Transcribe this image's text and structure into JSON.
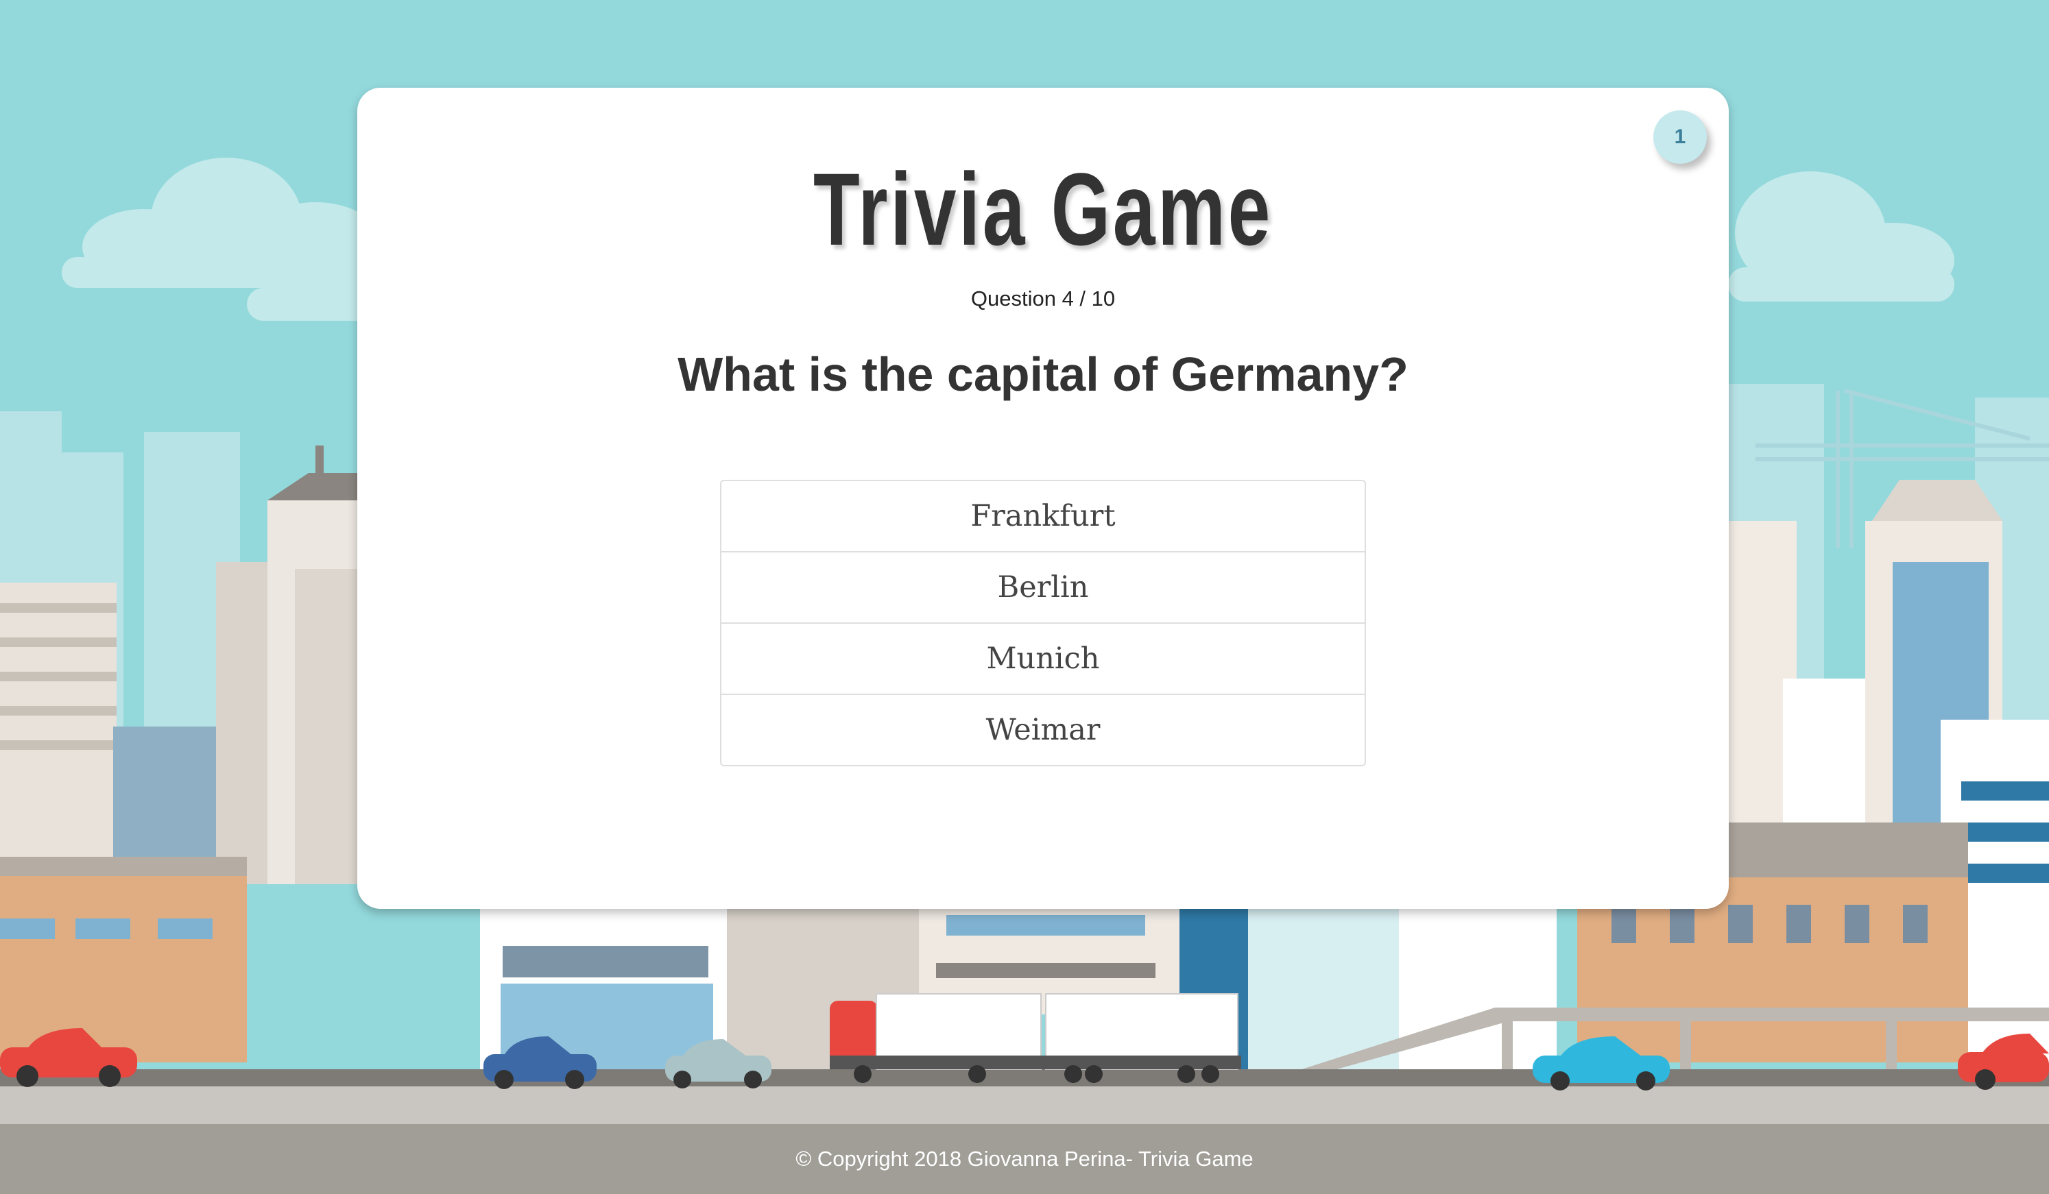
{
  "game": {
    "title": "Trivia Game",
    "timer": "1",
    "question_counter": "Question 4 / 10",
    "question": "What is the capital of Germany?",
    "answers": [
      "Frankfurt",
      "Berlin",
      "Munich",
      "Weimar"
    ]
  },
  "footer": {
    "text": "© Copyright 2018 Giovanna Perina- Trivia Game"
  },
  "colors": {
    "sky": "#93d9dc",
    "card": "#ffffff",
    "text": "#333333",
    "footer": "#a19e98",
    "timer_badge": "#c5e9ec"
  }
}
